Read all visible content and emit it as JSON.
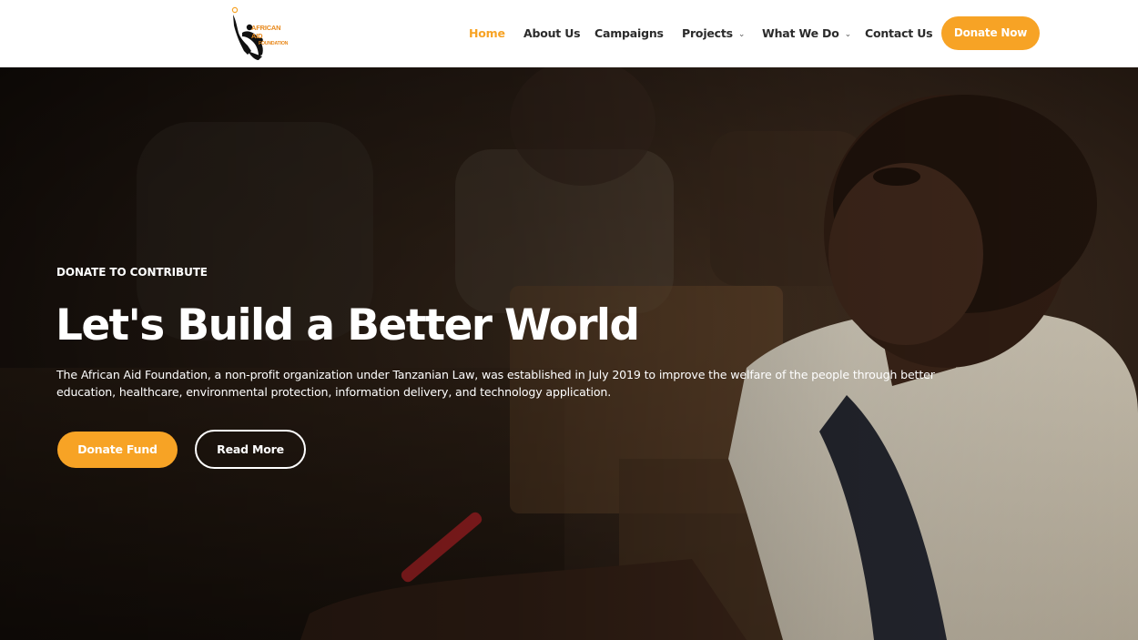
{
  "brand": {
    "logo_line1": "AFRICAN AID",
    "logo_line2": "FOUNDATION",
    "accent_color": "#f7a325"
  },
  "nav": {
    "items": [
      {
        "label": "Home",
        "active": true
      },
      {
        "label": "About Us"
      },
      {
        "label": "Campaigns"
      },
      {
        "label": "Projects",
        "has_dropdown": true
      },
      {
        "label": "What We Do",
        "has_dropdown": true
      },
      {
        "label": "Contact Us"
      }
    ],
    "cta_label": "Donate Now",
    "dropdown_icon": "chevron-down-icon"
  },
  "hero": {
    "eyebrow": "DONATE TO CONTRIBUTE",
    "headline": "Let's Build a Better World",
    "description": "The African Aid Foundation, a non-profit organization under Tanzanian Law, was established in July 2019 to improve the welfare of the people through better education, healthcare, environmental protection, information delivery, and technology application.",
    "primary_button": "Donate Fund",
    "secondary_button": "Read More"
  }
}
